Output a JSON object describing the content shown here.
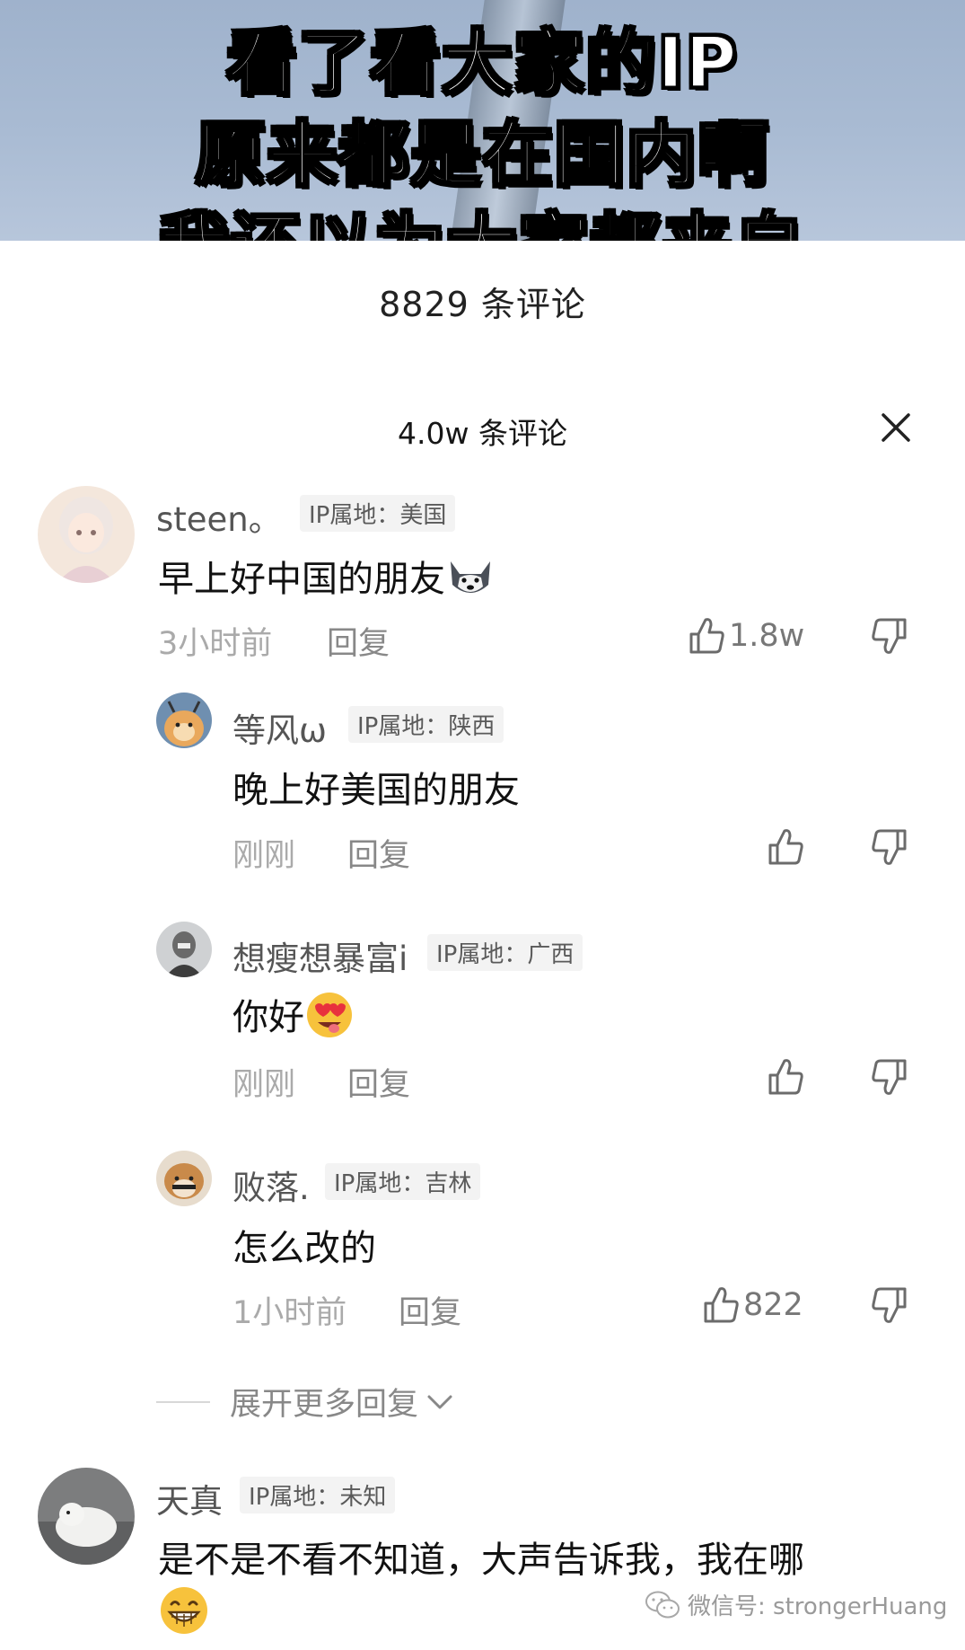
{
  "video_overlay": {
    "line1": "看了看大家的IP",
    "line2": "原来都是在国内啊",
    "line3": "我还以为大家都来自"
  },
  "comment_count_old": "8829 条评论",
  "comment_count": "4.0w 条评论",
  "comments": [
    {
      "user": "steen。",
      "ip": "IP属地：美国",
      "text": "早上好中国的朋友",
      "emoji": "husky-dog-emoji",
      "time": "3小时前",
      "reply": "回复",
      "likes": "1.8w",
      "replies": [
        {
          "user": "等风ω",
          "ip": "IP属地：陕西",
          "text": "晚上好美国的朋友",
          "time": "刚刚",
          "reply": "回复",
          "likes": ""
        },
        {
          "user": "想瘦想暴富i",
          "ip": "IP属地：广西",
          "text": "你好",
          "emoji": "heart-eyes-tongue-emoji",
          "time": "刚刚",
          "reply": "回复",
          "likes": ""
        },
        {
          "user": "败落.",
          "ip": "IP属地：吉林",
          "text": "怎么改的",
          "time": "1小时前",
          "reply": "回复",
          "likes": "822"
        }
      ],
      "expand_label": "展开更多回复"
    },
    {
      "user": "天真",
      "ip": "IP属地：未知",
      "text": "是不是不看不知道，大声告诉我，我在哪",
      "emoji": "grinning-emoji"
    }
  ],
  "watermark": "微信号: strongerHuang",
  "icons": {
    "close": "close-icon",
    "like": "thumbs-up-icon",
    "dislike": "thumbs-down-icon",
    "expand": "chevron-down-icon",
    "wechat": "wechat-icon"
  },
  "colors": {
    "text_primary": "#111111",
    "text_secondary": "#888888",
    "tag_background": "#f3f3f3",
    "video_sky": "#a9bbd3"
  }
}
